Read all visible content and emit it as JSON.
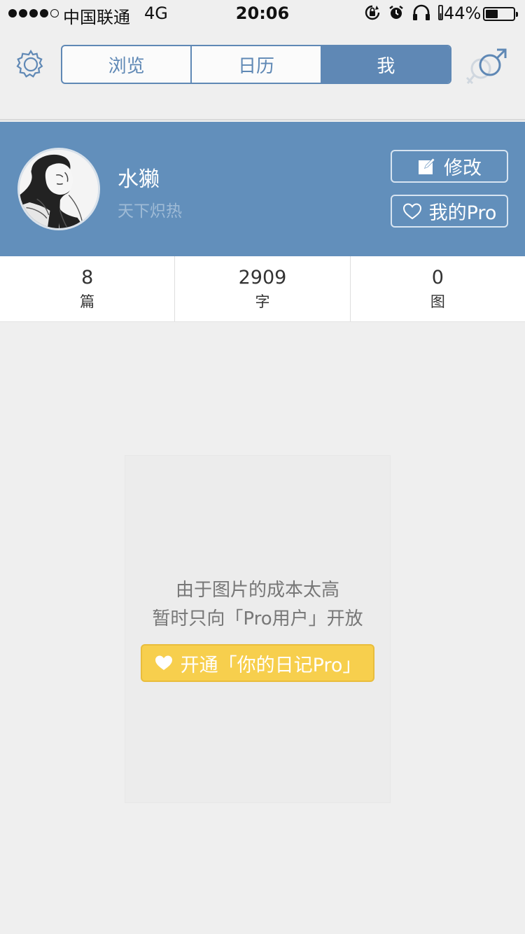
{
  "status_bar": {
    "carrier": "中国联通",
    "network": "4G",
    "time": "20:06",
    "battery_percent": "44%",
    "battery_level": 0.44
  },
  "nav": {
    "tabs": [
      {
        "label": "浏览",
        "active": false
      },
      {
        "label": "日历",
        "active": false
      },
      {
        "label": "我",
        "active": true
      }
    ],
    "settings_icon": "gear-icon",
    "gender_icon": "gender-male-female-icon"
  },
  "profile": {
    "name": "水獭",
    "motto": "天下炽热",
    "edit_label": "修改",
    "pro_label": "我的Pro"
  },
  "stats": [
    {
      "value": "8",
      "label": "篇"
    },
    {
      "value": "2909",
      "label": "字"
    },
    {
      "value": "0",
      "label": "图"
    }
  ],
  "notice": {
    "line1": "由于图片的成本太高",
    "line2": "暂时只向「Pro用户」开放",
    "button_label": "开通「你的日记Pro」"
  },
  "colors": {
    "accent": "#5f88b5",
    "profile_bg": "#628fbb",
    "button_yellow": "#f7cf4d",
    "page_bg": "#efefef"
  }
}
